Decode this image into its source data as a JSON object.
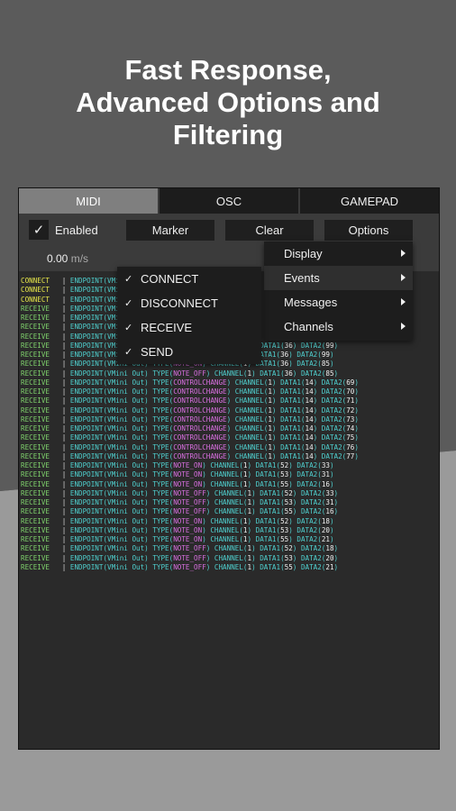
{
  "headline": {
    "line1": "Fast Response,",
    "line2": "Advanced Options and",
    "line3": "Filtering"
  },
  "tabs": [
    {
      "label": "MIDI",
      "active": true
    },
    {
      "label": "OSC",
      "active": false
    },
    {
      "label": "GAMEPAD",
      "active": false
    }
  ],
  "toolbar": {
    "enabled_label": "Enabled",
    "enabled_checked": true,
    "check_glyph": "✓",
    "marker_label": "Marker",
    "clear_label": "Clear",
    "options_label": "Options",
    "speed_value": "0.00",
    "speed_unit": "m/s"
  },
  "options_menu": {
    "items": [
      {
        "label": "Display"
      },
      {
        "label": "Events"
      },
      {
        "label": "Messages"
      },
      {
        "label": "Channels"
      }
    ]
  },
  "events_menu": {
    "items": [
      {
        "label": "CONNECT",
        "checked": true
      },
      {
        "label": "DISCONNECT",
        "checked": true
      },
      {
        "label": "RECEIVE",
        "checked": true
      },
      {
        "label": "SEND",
        "checked": true
      }
    ]
  },
  "log": {
    "rows": [
      {
        "ev": "CONNECT",
        "type": "",
        "ch": "",
        "d1": "",
        "d2": ""
      },
      {
        "ev": "CONNECT",
        "type": "",
        "ch": "",
        "d1": "",
        "d2": ""
      },
      {
        "ev": "CONNECT",
        "type": "",
        "ch": "",
        "d1": "",
        "d2": ""
      },
      {
        "ev": "RECEIVE",
        "type": "",
        "ch": "",
        "d1": "",
        "d2": ""
      },
      {
        "ev": "RECEIVE",
        "type": "",
        "ch": "",
        "d1": "",
        "d2": ""
      },
      {
        "ev": "RECEIVE",
        "type": "",
        "ch": "",
        "d1": "",
        "d2": ""
      },
      {
        "ev": "RECEIVE",
        "type": "",
        "ch": "",
        "d1": "",
        "d2": ""
      },
      {
        "ev": "RECEIVE",
        "type": "NOTE_OFF",
        "ch": "1",
        "d1": "36",
        "d2": "99"
      },
      {
        "ev": "RECEIVE",
        "type": "NOTE_ON",
        "ch": "1",
        "d1": "36",
        "d2": "99"
      },
      {
        "ev": "RECEIVE",
        "type": "NOTE_ON",
        "ch": "1",
        "d1": "36",
        "d2": "85"
      },
      {
        "ev": "RECEIVE",
        "type": "NOTE_OFF",
        "ch": "1",
        "d1": "36",
        "d2": "85"
      },
      {
        "ev": "RECEIVE",
        "type": "CONTROLCHANGE",
        "ch": "1",
        "d1": "14",
        "d2": "69"
      },
      {
        "ev": "RECEIVE",
        "type": "CONTROLCHANGE",
        "ch": "1",
        "d1": "14",
        "d2": "70"
      },
      {
        "ev": "RECEIVE",
        "type": "CONTROLCHANGE",
        "ch": "1",
        "d1": "14",
        "d2": "71"
      },
      {
        "ev": "RECEIVE",
        "type": "CONTROLCHANGE",
        "ch": "1",
        "d1": "14",
        "d2": "72"
      },
      {
        "ev": "RECEIVE",
        "type": "CONTROLCHANGE",
        "ch": "1",
        "d1": "14",
        "d2": "73"
      },
      {
        "ev": "RECEIVE",
        "type": "CONTROLCHANGE",
        "ch": "1",
        "d1": "14",
        "d2": "74"
      },
      {
        "ev": "RECEIVE",
        "type": "CONTROLCHANGE",
        "ch": "1",
        "d1": "14",
        "d2": "75"
      },
      {
        "ev": "RECEIVE",
        "type": "CONTROLCHANGE",
        "ch": "1",
        "d1": "14",
        "d2": "76"
      },
      {
        "ev": "RECEIVE",
        "type": "CONTROLCHANGE",
        "ch": "1",
        "d1": "14",
        "d2": "77"
      },
      {
        "ev": "RECEIVE",
        "type": "NOTE_ON",
        "ch": "1",
        "d1": "52",
        "d2": "33"
      },
      {
        "ev": "RECEIVE",
        "type": "NOTE_ON",
        "ch": "1",
        "d1": "53",
        "d2": "31"
      },
      {
        "ev": "RECEIVE",
        "type": "NOTE_ON",
        "ch": "1",
        "d1": "55",
        "d2": "16"
      },
      {
        "ev": "RECEIVE",
        "type": "NOTE_OFF",
        "ch": "1",
        "d1": "52",
        "d2": "33"
      },
      {
        "ev": "RECEIVE",
        "type": "NOTE_OFF",
        "ch": "1",
        "d1": "53",
        "d2": "31"
      },
      {
        "ev": "RECEIVE",
        "type": "NOTE_OFF",
        "ch": "1",
        "d1": "55",
        "d2": "16"
      },
      {
        "ev": "RECEIVE",
        "type": "NOTE_ON",
        "ch": "1",
        "d1": "52",
        "d2": "18"
      },
      {
        "ev": "RECEIVE",
        "type": "NOTE_ON",
        "ch": "1",
        "d1": "53",
        "d2": "20"
      },
      {
        "ev": "RECEIVE",
        "type": "NOTE_ON",
        "ch": "1",
        "d1": "55",
        "d2": "21"
      },
      {
        "ev": "RECEIVE",
        "type": "NOTE_OFF",
        "ch": "1",
        "d1": "52",
        "d2": "18"
      },
      {
        "ev": "RECEIVE",
        "type": "NOTE_OFF",
        "ch": "1",
        "d1": "53",
        "d2": "20"
      },
      {
        "ev": "RECEIVE",
        "type": "NOTE_OFF",
        "ch": "1",
        "d1": "55",
        "d2": "21"
      }
    ],
    "endpoint_text": "ENDPOINT(VMini Out)",
    "type_label": "TYPE",
    "channel_label": "CHANNEL",
    "data1_label": "DATA1",
    "data2_label": "DATA2",
    "colors": {
      "connect": "#e8e84a",
      "receive": "#7fd26c",
      "endpoint": "#4fd0cf",
      "type_value": "#d86fe0"
    }
  }
}
